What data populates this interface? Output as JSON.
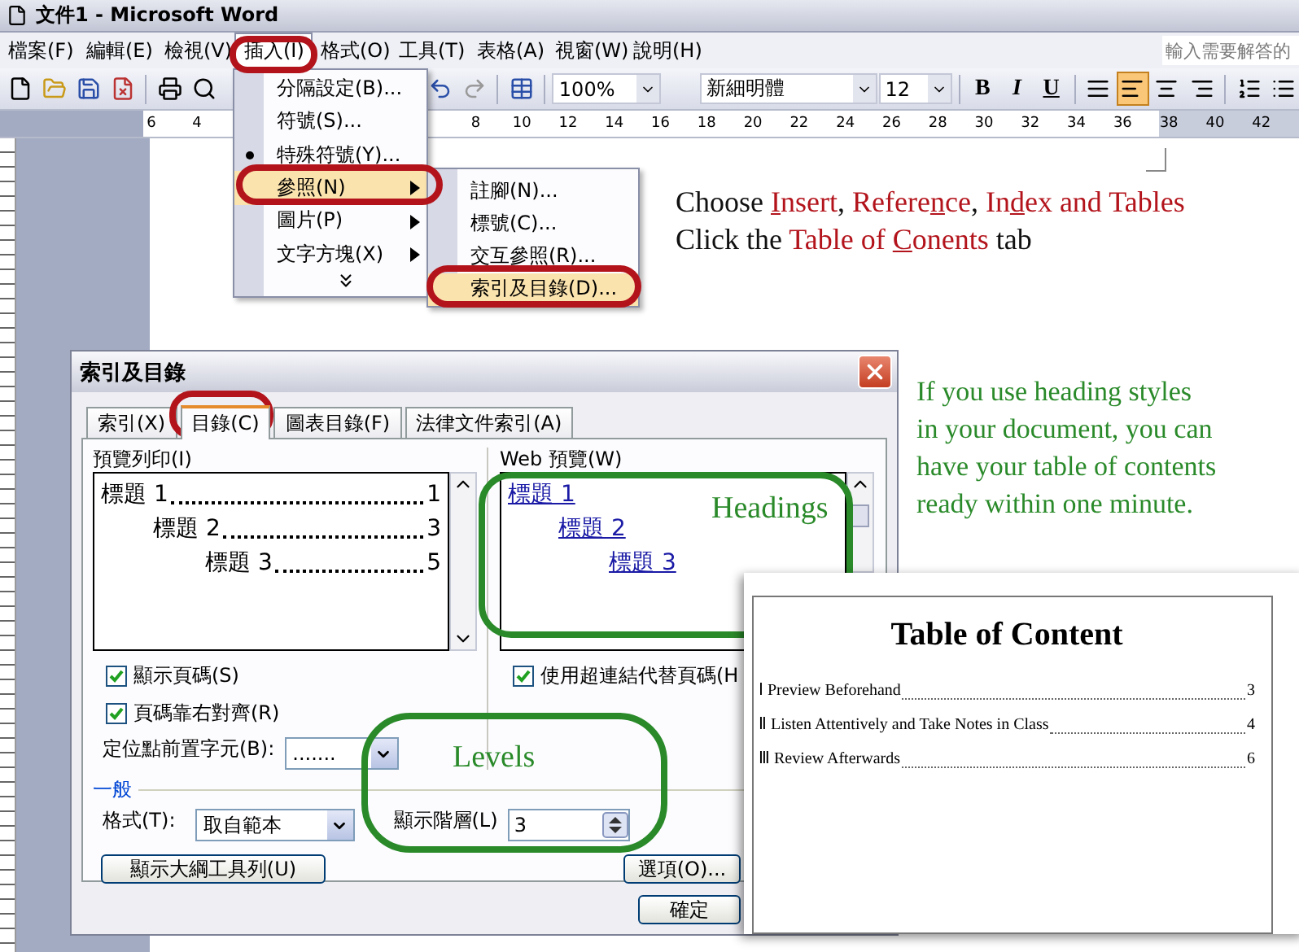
{
  "window": {
    "title": "文件1 - Microsoft Word"
  },
  "menu_bar": {
    "items": [
      {
        "label": "檔案(F)",
        "selected": false
      },
      {
        "label": "編輯(E)",
        "selected": false
      },
      {
        "label": "檢視(V)",
        "selected": false
      },
      {
        "label": "插入(I)",
        "selected": true
      },
      {
        "label": "格式(O)",
        "selected": false
      },
      {
        "label": "工具(T)",
        "selected": false
      },
      {
        "label": "表格(A)",
        "selected": false
      },
      {
        "label": "視窗(W)",
        "selected": false
      },
      {
        "label": "說明(H)",
        "selected": false
      }
    ],
    "help_field": {
      "placeholder": "輸入需要解答的"
    }
  },
  "toolbar": {
    "zoom": "100%",
    "font": "新細明體",
    "size": "12",
    "format_buttons": [
      "B",
      "I",
      "U"
    ],
    "align_buttons": [
      {
        "selected": false
      },
      {
        "selected": true
      },
      {
        "selected": false
      },
      {
        "selected": false
      }
    ]
  },
  "ruler": {
    "left_labels": [
      "6",
      "4"
    ],
    "right_labels": [
      "8",
      "10",
      "12",
      "14",
      "16",
      "18",
      "20",
      "22",
      "24",
      "26",
      "28",
      "30",
      "32",
      "34",
      "36",
      "38",
      "40",
      "42"
    ]
  },
  "insert_menu": {
    "items": [
      {
        "label": "分隔設定(B)...",
        "kind": "plain",
        "selected": false
      },
      {
        "label": "符號(S)...",
        "kind": "plain",
        "selected": false
      },
      {
        "label": "特殊符號(Y)...",
        "kind": "bullet",
        "selected": false
      },
      {
        "label": "參照(N)",
        "kind": "submenu",
        "selected": true
      },
      {
        "label": "圖片(P)",
        "kind": "submenu",
        "selected": false
      },
      {
        "label": "文字方塊(X)",
        "kind": "submenu",
        "selected": false
      }
    ]
  },
  "reference_submenu": {
    "items": [
      {
        "label": "註腳(N)...",
        "selected": false
      },
      {
        "label": "標號(C)...",
        "selected": false
      },
      {
        "label": "交互參照(R)...",
        "selected": false
      },
      {
        "label": "索引及目錄(D)...",
        "selected": true
      }
    ]
  },
  "instructions": [
    [
      {
        "text": "Choose ",
        "highlight": false,
        "underlined": false
      },
      {
        "text": "I",
        "highlight": true,
        "underlined": true
      },
      {
        "text": "nsert",
        "highlight": true,
        "underlined": false
      },
      {
        "text": ", ",
        "highlight": false,
        "underlined": false
      },
      {
        "text": "Refere",
        "highlight": true,
        "underlined": false
      },
      {
        "text": "n",
        "highlight": true,
        "underlined": true
      },
      {
        "text": "ce",
        "highlight": true,
        "underlined": false
      },
      {
        "text": ", ",
        "highlight": false,
        "underlined": false
      },
      {
        "text": "In",
        "highlight": true,
        "underlined": false
      },
      {
        "text": "d",
        "highlight": true,
        "underlined": true
      },
      {
        "text": "ex and Tables",
        "highlight": true,
        "underlined": false
      }
    ],
    [
      {
        "text": "Click the ",
        "highlight": false,
        "underlined": false
      },
      {
        "text": "Table of ",
        "highlight": true,
        "underlined": false
      },
      {
        "text": "C",
        "highlight": true,
        "underlined": true
      },
      {
        "text": "onents",
        "highlight": true,
        "underlined": false
      },
      {
        "text": " tab",
        "highlight": false,
        "underlined": false
      }
    ]
  ],
  "tip": [
    "If you use heading styles",
    "in your document, you can",
    "have your table of contents",
    "ready within one minute."
  ],
  "dialog": {
    "title": "索引及目錄",
    "tabs": [
      {
        "label": "索引(X)",
        "selected": false
      },
      {
        "label": "目錄(C)",
        "selected": true
      },
      {
        "label": "圖表目錄(F)",
        "selected": false
      },
      {
        "label": "法律文件索引(A)",
        "selected": false
      }
    ],
    "print_preview": {
      "label": "預覽列印(I)",
      "entries": [
        {
          "text": "標題 1",
          "page": "1",
          "children": [
            {
              "text": "標題 2",
              "page": "3",
              "children": [
                {
                  "text": "標題 3",
                  "page": "5"
                }
              ]
            }
          ]
        }
      ]
    },
    "web_preview": {
      "label": "Web 預覽(W)",
      "entries": [
        {
          "text": "標題 1",
          "children": [
            {
              "text": "標題 2",
              "children": [
                {
                  "text": "標題 3"
                }
              ]
            }
          ]
        }
      ]
    },
    "checkboxes": [
      {
        "label": "顯示頁碼(S)",
        "checked": true
      },
      {
        "label": "頁碼靠右對齊(R)",
        "checked": true
      }
    ],
    "hyperlink_checkbox": {
      "label": "使用超連結代替頁碼(H",
      "checked": true
    },
    "tab_leader": {
      "label": "定位點前置字元(B):",
      "value": "......."
    },
    "general_label": "一般",
    "format": {
      "label": "格式(T):",
      "value": "取自範本"
    },
    "levels": {
      "label": "顯示階層(L)",
      "value": "3"
    },
    "outline_button": "顯示大綱工具列(U)",
    "options_button": "選項(O)...",
    "ok_button": "確定"
  },
  "callouts": {
    "headings": "Headings",
    "levels": "Levels"
  },
  "toc_preview": {
    "title": "Table of Content",
    "entries": [
      {
        "text": "Ⅰ Preview Beforehand",
        "page": "3"
      },
      {
        "text": "Ⅱ Listen Attentively and Take Notes in Class",
        "page": "4"
      },
      {
        "text": "Ⅲ Review Afterwards",
        "page": "6"
      }
    ]
  }
}
